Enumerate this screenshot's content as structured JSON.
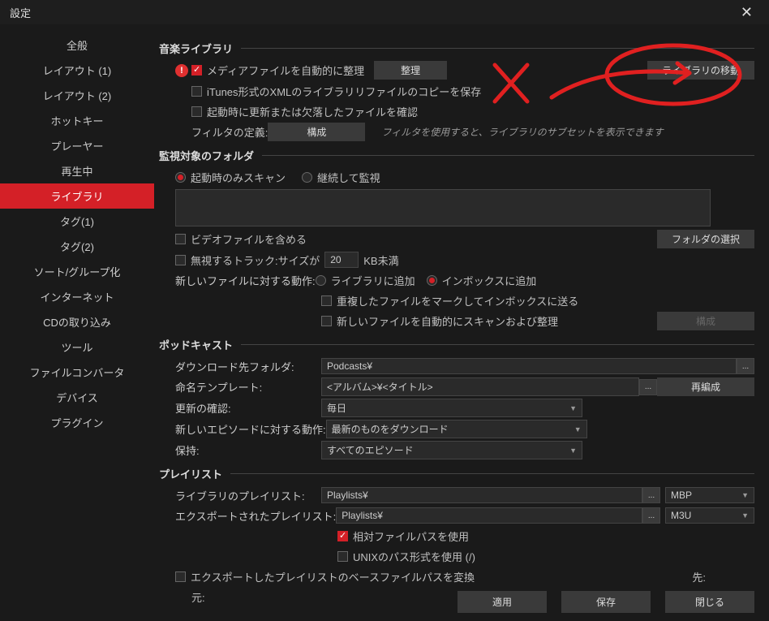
{
  "window": {
    "title": "設定",
    "close_label": "✕"
  },
  "sidebar": {
    "items": [
      {
        "label": "全般"
      },
      {
        "label": "レイアウト (1)"
      },
      {
        "label": "レイアウト (2)"
      },
      {
        "label": "ホットキー"
      },
      {
        "label": "プレーヤー"
      },
      {
        "label": "再生中"
      },
      {
        "label": "ライブラリ"
      },
      {
        "label": "タグ(1)"
      },
      {
        "label": "タグ(2)"
      },
      {
        "label": "ソート/グループ化"
      },
      {
        "label": "インターネット"
      },
      {
        "label": "CDの取り込み"
      },
      {
        "label": "ツール"
      },
      {
        "label": "ファイルコンバータ"
      },
      {
        "label": "デバイス"
      },
      {
        "label": "プラグイン"
      }
    ],
    "active_index": 6
  },
  "music_library": {
    "header": "音楽ライブラリ",
    "auto_organise_label": "メディアファイルを自動的に整理",
    "organise_btn": "整理",
    "move_library_btn": "ライブラリの移動",
    "itunes_xml_label": "iTunes形式のXMLのライブラリリファイルのコピーを保存",
    "startup_check_label": "起動時に更新または欠落したファイルを確認",
    "filter_def_label": "フィルタの定義:",
    "config_btn": "構成",
    "filter_hint": "フィルタを使用すると、ライブラリのサブセットを表示できます"
  },
  "monitored": {
    "header": "監視対象のフォルダ",
    "scan_startup": "起動時のみスキャン",
    "scan_continuous": "継続して監視",
    "include_video": "ビデオファイルを含める",
    "choose_folder_btn": "フォルダの選択",
    "ignore_tracks_label": "無視するトラック:サイズが",
    "ignore_tracks_value": "20",
    "ignore_tracks_unit": "KB未満",
    "new_files_action_label": "新しいファイルに対する動作:",
    "add_to_library": "ライブラリに追加",
    "add_to_inbox": "インボックスに追加",
    "mark_dup_label": "重複したファイルをマークしてインボックスに送る",
    "auto_scan_label": "新しいファイルを自動的にスキャンおよび整理",
    "config_btn": "構成"
  },
  "podcast": {
    "header": "ポッドキャスト",
    "download_folder_label": "ダウンロード先フォルダ:",
    "download_folder_value": "Podcasts¥",
    "naming_template_label": "命名テンプレート:",
    "naming_template_value": "<アルバム>¥<タイトル>",
    "regroup_btn": "再編成",
    "update_check_label": "更新の確認:",
    "update_check_value": "毎日",
    "new_ep_action_label": "新しいエピソードに対する動作:",
    "new_ep_action_value": "最新のものをダウンロード",
    "keep_label": "保持:",
    "keep_value": "すべてのエピソード"
  },
  "playlist": {
    "header": "プレイリスト",
    "library_pl_label": "ライブラリのプレイリスト:",
    "library_pl_value": "Playlists¥",
    "library_pl_format": "MBP",
    "exported_pl_label": "エクスポートされたプレイリスト:",
    "exported_pl_value": "Playlists¥",
    "exported_pl_format": "M3U",
    "relative_path_label": "相対ファイルパスを使用",
    "unix_path_label": "UNIXのパス形式を使用 (/)",
    "convert_base_label": "エクスポートしたプレイリストのベースファイルパスを変換",
    "from_label": "元:",
    "to_label": "先:"
  },
  "footer": {
    "apply": "適用",
    "save": "保存",
    "close": "閉じる"
  }
}
